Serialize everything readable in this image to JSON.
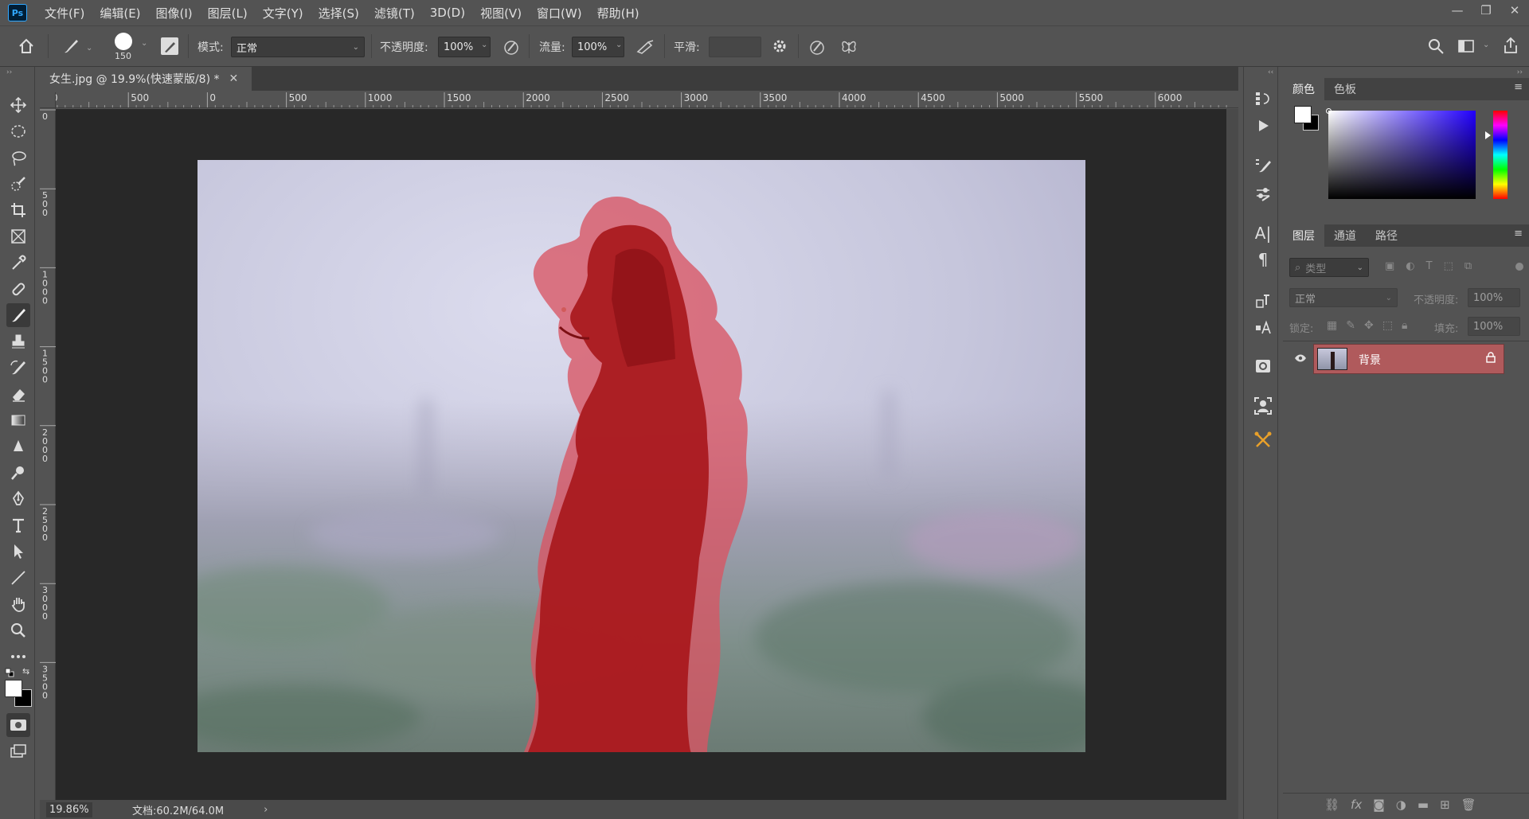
{
  "app": {
    "logo": "Ps"
  },
  "menu": [
    "文件(F)",
    "编辑(E)",
    "图像(I)",
    "图层(L)",
    "文字(Y)",
    "选择(S)",
    "滤镜(T)",
    "3D(D)",
    "视图(V)",
    "窗口(W)",
    "帮助(H)"
  ],
  "options": {
    "brush_size": "150",
    "mode_label": "模式:",
    "mode_value": "正常",
    "opacity_label": "不透明度:",
    "opacity_value": "100%",
    "flow_label": "流量:",
    "flow_value": "100%",
    "smooth_label": "平滑:"
  },
  "document": {
    "tab_title": "女生.jpg @ 19.9%(快速蒙版/8) *",
    "ruler_ticks": [
      "0",
      "500",
      "0",
      "500",
      "1000",
      "1500",
      "2000",
      "2500",
      "3000",
      "3500",
      "4000",
      "4500",
      "5000",
      "5500",
      "6000"
    ],
    "vruler_ticks": [
      "0",
      "5\n0\n0",
      "1\n0\n0\n0",
      "1\n5\n0\n0",
      "2\n0\n0\n0",
      "2\n5\n0\n0",
      "3\n0\n0\n0",
      "3\n5\n0\n0"
    ],
    "zoom": "19.86%",
    "doc_info": "文档:60.2M/64.0M",
    "mask_color": "#c8191e",
    "sky_color": "#cfd0e3"
  },
  "color_panel": {
    "tabs": [
      "颜色",
      "色板"
    ],
    "foreground": "#ffffff",
    "background": "#000000"
  },
  "layers_panel": {
    "tabs": [
      "图层",
      "通道",
      "路径"
    ],
    "filter_placeholder": "类型",
    "blend_mode": "正常",
    "opacity_label": "不透明度:",
    "opacity_value": "100%",
    "lock_label": "锁定:",
    "fill_label": "填充:",
    "fill_value": "100%",
    "layers": [
      {
        "name": "背景",
        "visible": true,
        "locked": true
      }
    ]
  }
}
